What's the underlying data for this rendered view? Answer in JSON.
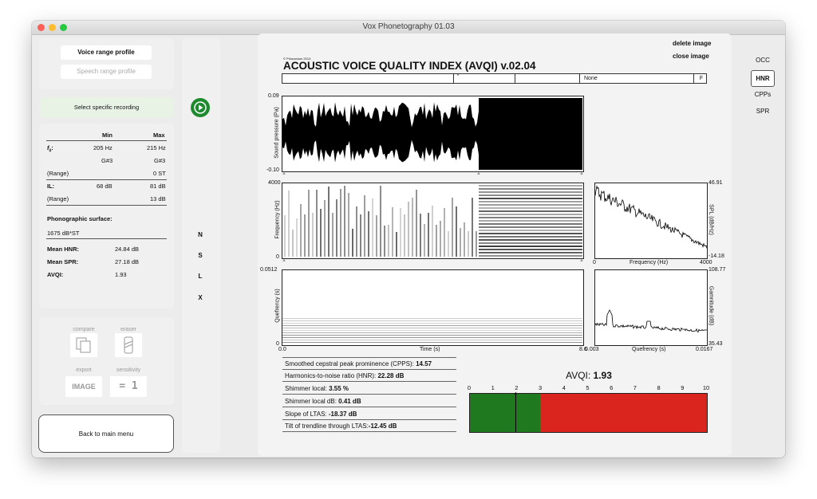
{
  "window": {
    "title": "Vox Phonetography 01.03"
  },
  "left_panel": {
    "voice_range_profile": "Voice range profile",
    "speech_range_profile": "Speech range profile",
    "select_recording": "Select specific recording",
    "table": {
      "col_min": "Min",
      "col_max": "Max",
      "f0_label": "f",
      "f0_sub": "0",
      "f0_colon": ":",
      "f0_min": "205 Hz",
      "f0_max": "215 Hz",
      "f0_note_min": "G#3",
      "f0_note_max": "G#3",
      "range_label": "(Range)",
      "f0_range": "0 ST",
      "il_label": "IL:",
      "il_min": "68 dB",
      "il_max": "81 dB",
      "il_range": "13 dB"
    },
    "phonographic_surface_label": "Phonographic surface:",
    "phonographic_surface_value": "1675 dB*ST",
    "mean_hnr_label": "Mean HNR:",
    "mean_hnr_value": "24.84 dB",
    "mean_spr_label": "Mean SPR:",
    "mean_spr_value": "27.18 dB",
    "avqi_label": "AVQI:",
    "avqi_value": "1.93",
    "tools": {
      "compare": "compare",
      "eraser": "eraser",
      "export": "export",
      "export_value": "IMAGE",
      "sensitivity": "sensitivity",
      "sensitivity_value": "= 1"
    },
    "back_button": "Back to main menu"
  },
  "mid_controls": {
    "play_icon": "play-icon",
    "buttons": [
      "N",
      "S",
      "L",
      "X"
    ]
  },
  "report": {
    "delete_image": "delete image",
    "close_image": "close image",
    "copyright": "© Phonanium 2013",
    "heading": "ACOUSTIC VOICE QUALITY INDEX (AVQI) v.02.04",
    "info_cells": [
      "",
      "\"",
      "",
      "None",
      "F"
    ],
    "waveform": {
      "ylabel": "Sound pressure (Pa)",
      "ytop": "0.09",
      "ybottom": "-0.10"
    },
    "spectrogram": {
      "ylabel": "Frequency (Hz)",
      "ytop": "4000",
      "ybottom": "0"
    },
    "cepstrogram": {
      "ylabel": "Quefrency (s)",
      "ytop": "0.0512",
      "ybottom": "0",
      "xlabel": "Time (s)",
      "xmin": "0.0",
      "xmax": "8.6"
    },
    "ltas": {
      "ylabel": "SPL (dB/Hz)",
      "ytop": "46.91",
      "ybottom": "-14.18",
      "xlabel": "Frequency (Hz)",
      "xmin": "0",
      "xmax": "4000"
    },
    "cepstrum": {
      "ylabel": "Gamnitude (dB)",
      "ytop": "108.77",
      "ybottom": "35.43",
      "xlabel": "Quefrency (s)",
      "xmin": "0.003",
      "xmax": "0.0167"
    },
    "measures": [
      {
        "label": "Smoothed cepstral peak prominence (CPPS): ",
        "value": "14.57"
      },
      {
        "label": "Harmonics-to-noise ratio (HNR): ",
        "value": "22.28 dB"
      },
      {
        "label": "Shimmer local: ",
        "value": "3.55 %"
      },
      {
        "label": "Shimmer local dB: ",
        "value": "0.41 dB"
      },
      {
        "label": "Slope of LTAS: ",
        "value": "-18.37 dB"
      },
      {
        "label": "Tilt of trendline through LTAS:",
        "value": "-12.45 dB"
      }
    ],
    "avqi_scale": {
      "label": "AVQI: ",
      "value": "1.93",
      "ticks": [
        "0",
        "1",
        "2",
        "3",
        "4",
        "5",
        "6",
        "7",
        "8",
        "9",
        "10"
      ],
      "marker": 1.93,
      "threshold": 2.95,
      "max": 10,
      "green": "#1f7a1f",
      "red": "#d9251d"
    }
  },
  "right_tabs": {
    "items": [
      "OCC",
      "HNR",
      "CPPs",
      "SPR"
    ],
    "selected": "HNR"
  },
  "colors": {
    "play_button": "#1e8a2e",
    "close": "#fe5f57",
    "minimize": "#febc2e",
    "maximize": "#28c840"
  }
}
